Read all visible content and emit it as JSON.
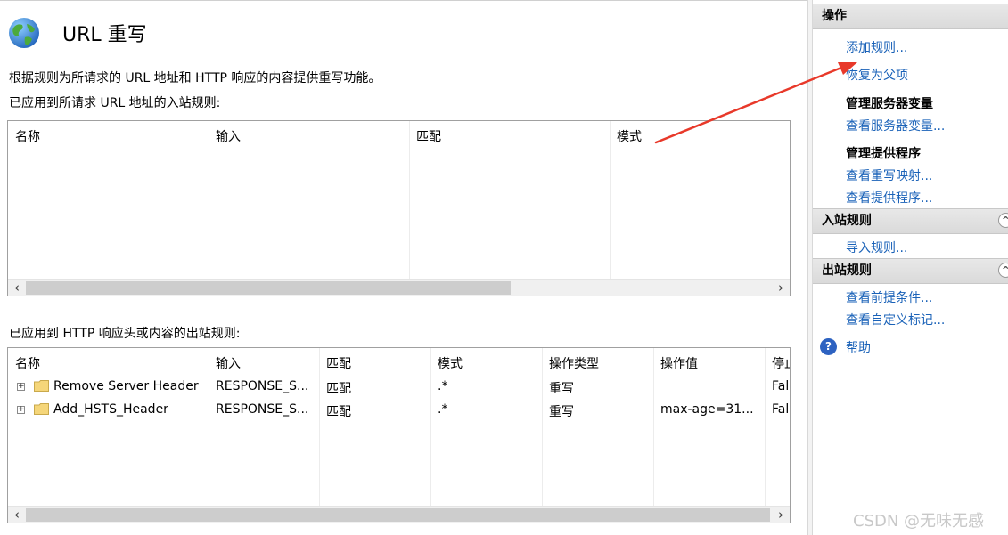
{
  "page": {
    "title": "URL 重写",
    "description": "根据规则为所请求的 URL 地址和 HTTP 响应的内容提供重写功能。",
    "inbound_caption": "已应用到所请求 URL 地址的入站规则:",
    "outbound_caption": "已应用到 HTTP 响应头或内容的出站规则:"
  },
  "inbound_table": {
    "columns": [
      "名称",
      "输入",
      "匹配",
      "模式"
    ]
  },
  "outbound_table": {
    "columns": [
      "名称",
      "输入",
      "匹配",
      "模式",
      "操作类型",
      "操作值",
      "停止"
    ],
    "rows": [
      {
        "name": "Remove Server Header",
        "input": "RESPONSE_S...",
        "match": "匹配",
        "pattern": ".*",
        "action_type": "重写",
        "action_value": "",
        "stop": "Fal"
      },
      {
        "name": "Add_HSTS_Header",
        "input": "RESPONSE_S...",
        "match": "匹配",
        "pattern": ".*",
        "action_type": "重写",
        "action_value": "max-age=31...",
        "stop": "Fal"
      }
    ]
  },
  "actions": {
    "header": "操作",
    "add_rule": "添加规则...",
    "revert_parent": "恢复为父项",
    "server_vars_group": "管理服务器变量",
    "view_server_vars": "查看服务器变量...",
    "providers_group": "管理提供程序",
    "view_rewrite_maps": "查看重写映射...",
    "view_providers": "查看提供程序...",
    "inbound_header": "入站规则",
    "import_rules": "导入规则...",
    "outbound_header": "出站规则",
    "view_preconditions": "查看前提条件...",
    "view_custom_tags": "查看自定义标记...",
    "help": "帮助"
  },
  "watermark": "CSDN @无味无感",
  "colors": {
    "link": "#1a62b8",
    "annotation_arrow": "#e8392a"
  },
  "icons": {
    "scroll_left": "‹",
    "scroll_right": "›",
    "expand": "+",
    "collapse": "^",
    "help": "?"
  }
}
